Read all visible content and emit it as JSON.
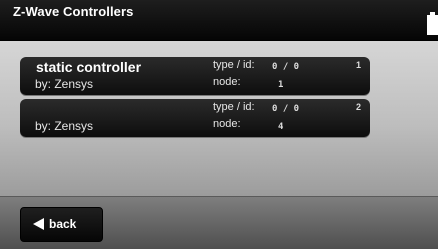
{
  "header": {
    "title": "Z-Wave Controllers",
    "corner_icon": "battery-icon"
  },
  "controllers": [
    {
      "name": "static controller",
      "by": "by: Zensys",
      "type_id_label": "type / id:",
      "type_id_value": "0 / 0",
      "node_label": "node:",
      "node_value": "1",
      "index": "1"
    },
    {
      "name": "",
      "by": "by: Zensys",
      "type_id_label": "type / id:",
      "type_id_value": "0 / 0",
      "node_label": "node:",
      "node_value": "4",
      "index": "2"
    }
  ],
  "footer": {
    "back_label": "back",
    "back_icon": "left-arrow-icon"
  },
  "colors": {
    "header_bg": "#0d0d0d",
    "card_bg": "#1a1a1a",
    "text": "#ffffff",
    "background": "#b9b9b9"
  }
}
